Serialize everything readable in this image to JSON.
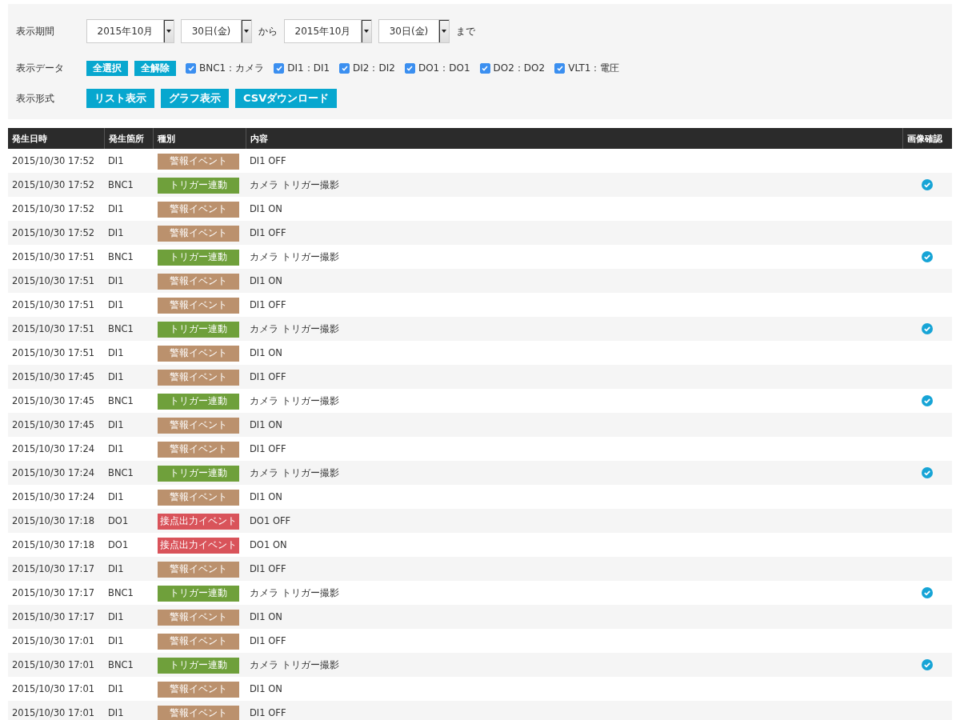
{
  "filters": {
    "period": {
      "label": "表示期間",
      "from_month": "2015年10月",
      "from_day": "30日(金)",
      "from_word": "から",
      "to_month": "2015年10月",
      "to_day": "30日(金)",
      "to_word": "まで"
    },
    "data": {
      "label": "表示データ",
      "buttons": [
        "全選択",
        "全解除"
      ],
      "items": [
        {
          "label": "BNC1：カメラ",
          "checked": true
        },
        {
          "label": "DI1：DI1",
          "checked": true
        },
        {
          "label": "DI2：DI2",
          "checked": true
        },
        {
          "label": "DO1：DO1",
          "checked": true
        },
        {
          "label": "DO2：DO2",
          "checked": true
        },
        {
          "label": "VLT1：電圧",
          "checked": true
        }
      ]
    },
    "format": {
      "label": "表示形式",
      "buttons": [
        "リスト表示",
        "グラフ表示",
        "CSVダウンロード"
      ]
    }
  },
  "table": {
    "columns": [
      "発生日時",
      "発生箇所",
      "種別",
      "内容",
      "画像確認"
    ],
    "rows": [
      {
        "time": "2015/10/30 17:52",
        "place": "DI1",
        "kind": "alarm",
        "type": "警報イベント",
        "content": "DI1 OFF",
        "image": false
      },
      {
        "time": "2015/10/30 17:52",
        "place": "BNC1",
        "kind": "trigger",
        "type": "トリガー連動",
        "content": "カメラ トリガー撮影",
        "image": true
      },
      {
        "time": "2015/10/30 17:52",
        "place": "DI1",
        "kind": "alarm",
        "type": "警報イベント",
        "content": "DI1 ON",
        "image": false
      },
      {
        "time": "2015/10/30 17:52",
        "place": "DI1",
        "kind": "alarm",
        "type": "警報イベント",
        "content": "DI1 OFF",
        "image": false
      },
      {
        "time": "2015/10/30 17:51",
        "place": "BNC1",
        "kind": "trigger",
        "type": "トリガー連動",
        "content": "カメラ トリガー撮影",
        "image": true
      },
      {
        "time": "2015/10/30 17:51",
        "place": "DI1",
        "kind": "alarm",
        "type": "警報イベント",
        "content": "DI1 ON",
        "image": false
      },
      {
        "time": "2015/10/30 17:51",
        "place": "DI1",
        "kind": "alarm",
        "type": "警報イベント",
        "content": "DI1 OFF",
        "image": false
      },
      {
        "time": "2015/10/30 17:51",
        "place": "BNC1",
        "kind": "trigger",
        "type": "トリガー連動",
        "content": "カメラ トリガー撮影",
        "image": true
      },
      {
        "time": "2015/10/30 17:51",
        "place": "DI1",
        "kind": "alarm",
        "type": "警報イベント",
        "content": "DI1 ON",
        "image": false
      },
      {
        "time": "2015/10/30 17:45",
        "place": "DI1",
        "kind": "alarm",
        "type": "警報イベント",
        "content": "DI1 OFF",
        "image": false
      },
      {
        "time": "2015/10/30 17:45",
        "place": "BNC1",
        "kind": "trigger",
        "type": "トリガー連動",
        "content": "カメラ トリガー撮影",
        "image": true
      },
      {
        "time": "2015/10/30 17:45",
        "place": "DI1",
        "kind": "alarm",
        "type": "警報イベント",
        "content": "DI1 ON",
        "image": false
      },
      {
        "time": "2015/10/30 17:24",
        "place": "DI1",
        "kind": "alarm",
        "type": "警報イベント",
        "content": "DI1 OFF",
        "image": false
      },
      {
        "time": "2015/10/30 17:24",
        "place": "BNC1",
        "kind": "trigger",
        "type": "トリガー連動",
        "content": "カメラ トリガー撮影",
        "image": true
      },
      {
        "time": "2015/10/30 17:24",
        "place": "DI1",
        "kind": "alarm",
        "type": "警報イベント",
        "content": "DI1 ON",
        "image": false
      },
      {
        "time": "2015/10/30 17:18",
        "place": "DO1",
        "kind": "contact",
        "type": "接点出力イベント",
        "content": "DO1 OFF",
        "image": false
      },
      {
        "time": "2015/10/30 17:18",
        "place": "DO1",
        "kind": "contact",
        "type": "接点出力イベント",
        "content": "DO1 ON",
        "image": false
      },
      {
        "time": "2015/10/30 17:17",
        "place": "DI1",
        "kind": "alarm",
        "type": "警報イベント",
        "content": "DI1 OFF",
        "image": false
      },
      {
        "time": "2015/10/30 17:17",
        "place": "BNC1",
        "kind": "trigger",
        "type": "トリガー連動",
        "content": "カメラ トリガー撮影",
        "image": true
      },
      {
        "time": "2015/10/30 17:17",
        "place": "DI1",
        "kind": "alarm",
        "type": "警報イベント",
        "content": "DI1 ON",
        "image": false
      },
      {
        "time": "2015/10/30 17:01",
        "place": "DI1",
        "kind": "alarm",
        "type": "警報イベント",
        "content": "DI1 OFF",
        "image": false
      },
      {
        "time": "2015/10/30 17:01",
        "place": "BNC1",
        "kind": "trigger",
        "type": "トリガー連動",
        "content": "カメラ トリガー撮影",
        "image": true
      },
      {
        "time": "2015/10/30 17:01",
        "place": "DI1",
        "kind": "alarm",
        "type": "警報イベント",
        "content": "DI1 ON",
        "image": false
      },
      {
        "time": "2015/10/30 17:01",
        "place": "DI1",
        "kind": "alarm",
        "type": "警報イベント",
        "content": "DI1 OFF",
        "image": false
      }
    ]
  }
}
